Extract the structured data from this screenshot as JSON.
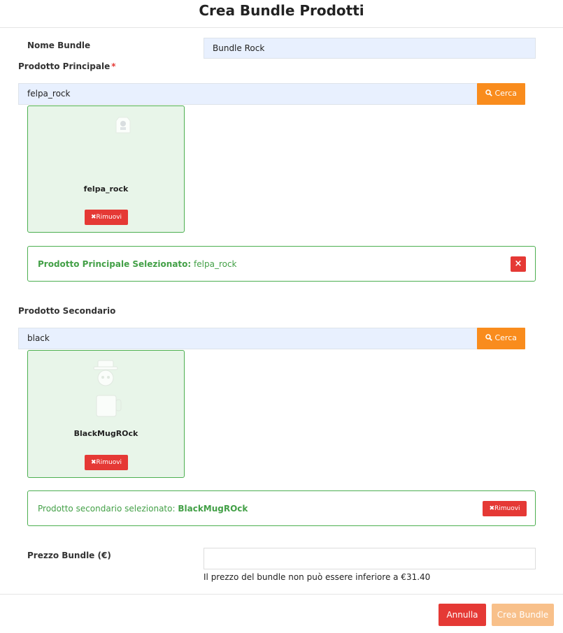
{
  "dialog": {
    "title": "Crea Bundle Prodotti"
  },
  "bundle_name": {
    "label": "Nome Bundle",
    "value": "Bundle Rock"
  },
  "main_product": {
    "label": "Prodotto Principale",
    "required_mark": "*",
    "search_value": "felpa_rock",
    "search_button": "Cerca",
    "card_name": "felpa_rock",
    "remove_button": "Rimuovi",
    "alert_label": "Prodotto Principale Selezionato:",
    "alert_value": "felpa_rock",
    "alert_close": "×"
  },
  "secondary_product": {
    "label": "Prodotto Secondario",
    "search_value": "black",
    "search_button": "Cerca",
    "card_name": "BlackMugROck",
    "remove_button": "Rimuovi",
    "alert_label": "Prodotto secondario selezionato:",
    "alert_value": "BlackMugROck",
    "alert_remove": "Rimuovi"
  },
  "price": {
    "label": "Prezzo Bundle (€)",
    "value": "",
    "help": "Il prezzo del bundle non può essere inferiore a €31.40"
  },
  "footer": {
    "cancel": "Annulla",
    "create": "Crea Bundle"
  },
  "colors": {
    "accent_orange": "#f98c1d",
    "danger_red": "#e53935",
    "success_green": "#4caf50",
    "input_blue": "#e8f0fe"
  }
}
